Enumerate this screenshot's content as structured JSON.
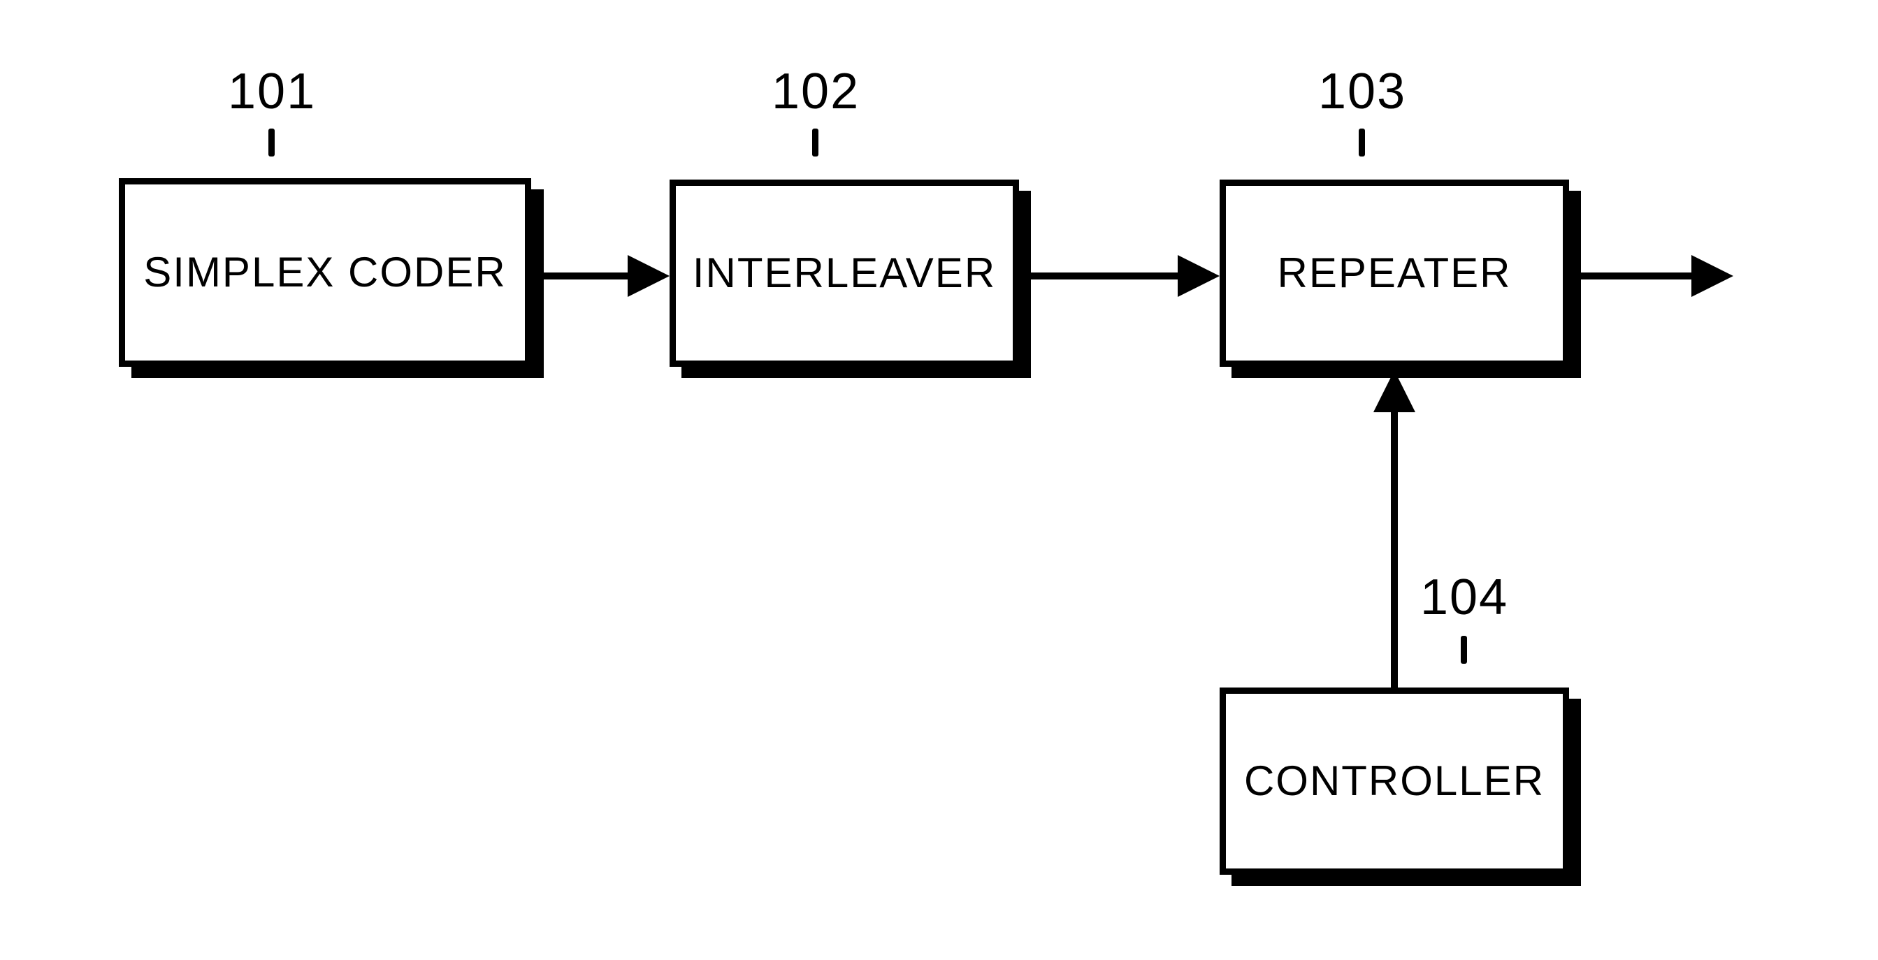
{
  "diagram": {
    "type": "block-diagram",
    "blocks": [
      {
        "id": "simplex-coder",
        "ref": "101",
        "label": "SIMPLEX CODER"
      },
      {
        "id": "interleaver",
        "ref": "102",
        "label": "INTERLEAVER"
      },
      {
        "id": "repeater",
        "ref": "103",
        "label": "REPEATER"
      },
      {
        "id": "controller",
        "ref": "104",
        "label": "CONTROLLER"
      }
    ],
    "edges": [
      {
        "from": "simplex-coder",
        "to": "interleaver"
      },
      {
        "from": "interleaver",
        "to": "repeater"
      },
      {
        "from": "controller",
        "to": "repeater"
      },
      {
        "from": "repeater",
        "to": "output"
      }
    ]
  },
  "refs": {
    "b101": "101",
    "b102": "102",
    "b103": "103",
    "b104": "104"
  },
  "labels": {
    "b101": "SIMPLEX CODER",
    "b102": "INTERLEAVER",
    "b103": "REPEATER",
    "b104": "CONTROLLER"
  }
}
